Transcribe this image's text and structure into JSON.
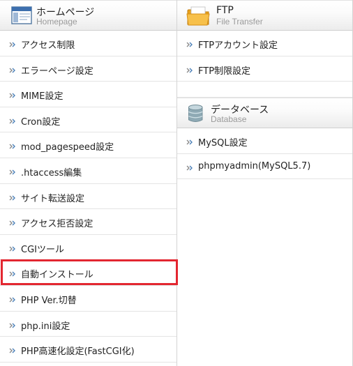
{
  "homepage": {
    "title": "ホームページ",
    "subtitle": "Homepage",
    "items": [
      {
        "label": "アクセス制限"
      },
      {
        "label": "エラーページ設定"
      },
      {
        "label": "MIME設定"
      },
      {
        "label": "Cron設定"
      },
      {
        "label": "mod_pagespeed設定"
      },
      {
        "label": ".htaccess編集"
      },
      {
        "label": "サイト転送設定"
      },
      {
        "label": "アクセス拒否設定"
      },
      {
        "label": "CGIツール"
      },
      {
        "label": "自動インストール"
      },
      {
        "label": "PHP Ver.切替"
      },
      {
        "label": "php.ini設定"
      },
      {
        "label": "PHP高速化設定(FastCGI化)"
      }
    ],
    "highlighted_item": "自動インストール",
    "highlight_color": "#e32630"
  },
  "ftp": {
    "title": "FTP",
    "subtitle": "File Transfer",
    "icon": "folder-icon",
    "items": [
      {
        "label": "FTPアカウント設定"
      },
      {
        "label": "FTP制限設定"
      }
    ]
  },
  "database": {
    "title": "データベース",
    "subtitle": "Database",
    "icon": "database-icon",
    "items": [
      {
        "label": "MySQL設定"
      },
      {
        "label": "phpmyadmin(MySQL5.7)"
      }
    ]
  }
}
